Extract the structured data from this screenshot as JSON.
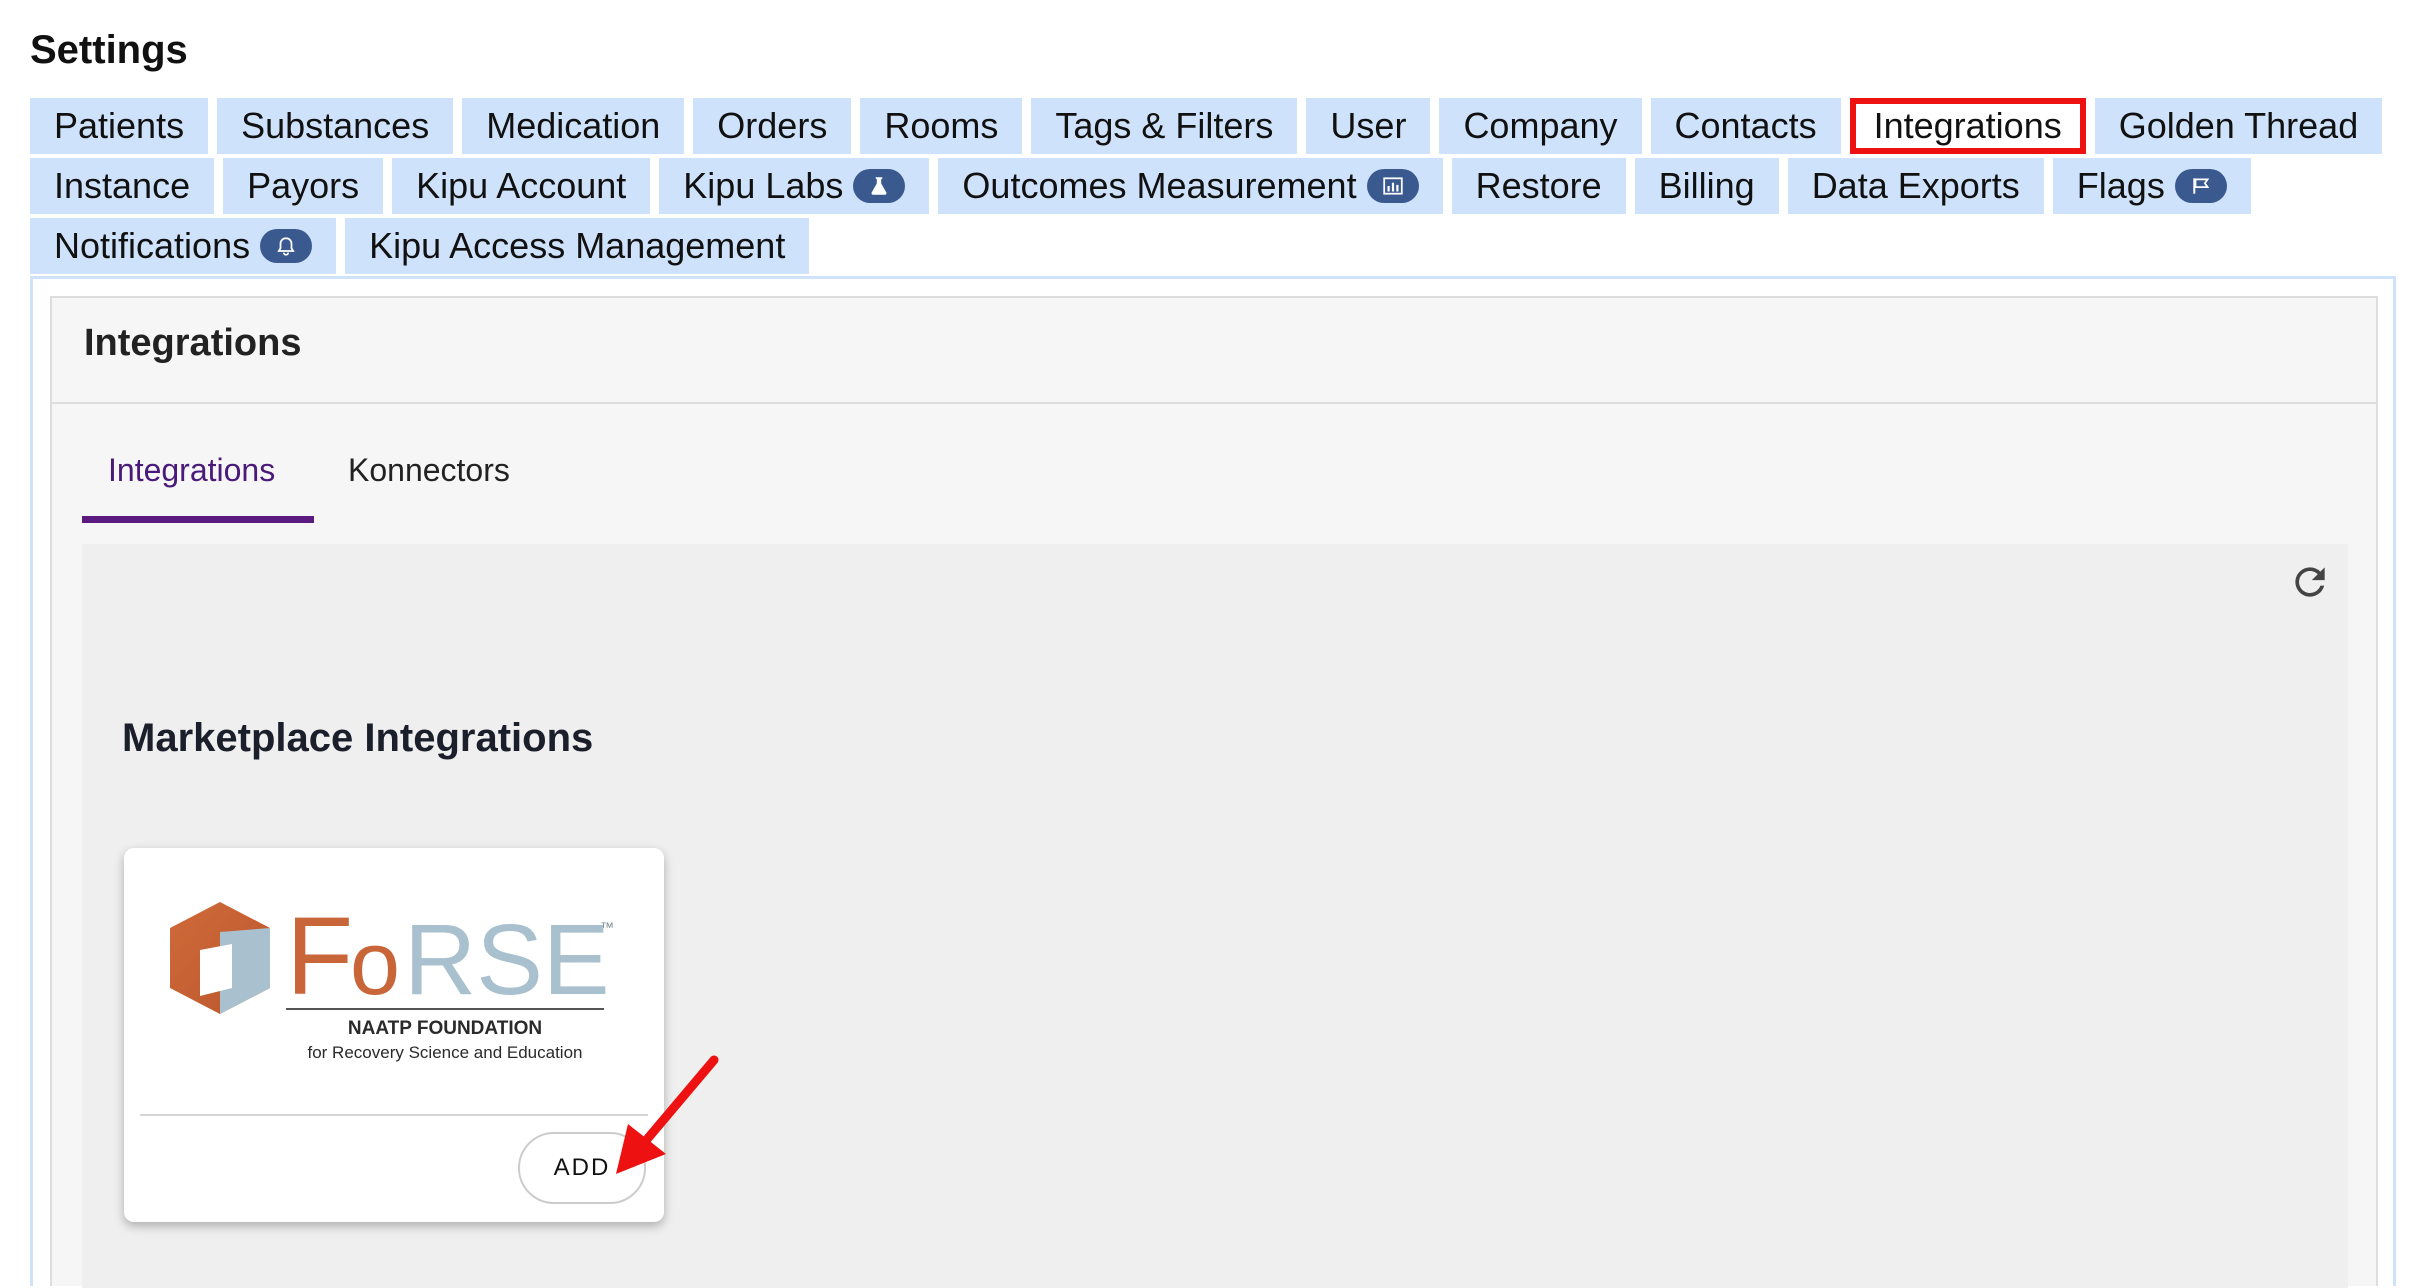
{
  "page": {
    "title": "Settings"
  },
  "tabs": {
    "rows": [
      [
        {
          "label": "Patients"
        },
        {
          "label": "Substances"
        },
        {
          "label": "Medication"
        },
        {
          "label": "Orders"
        },
        {
          "label": "Rooms"
        },
        {
          "label": "Tags & Filters"
        },
        {
          "label": "User"
        },
        {
          "label": "Company"
        },
        {
          "label": "Contacts"
        },
        {
          "label": "Integrations",
          "active": true
        },
        {
          "label": "Golden Thread"
        }
      ],
      [
        {
          "label": "Instance"
        },
        {
          "label": "Payors"
        },
        {
          "label": "Kipu Account"
        },
        {
          "label": "Kipu Labs",
          "badge": "flask-icon"
        },
        {
          "label": "Outcomes Measurement",
          "badge": "bar-chart-icon"
        },
        {
          "label": "Restore"
        },
        {
          "label": "Billing"
        },
        {
          "label": "Data Exports"
        },
        {
          "label": "Flags",
          "badge": "flag-icon"
        }
      ],
      [
        {
          "label": "Notifications",
          "badge": "bell-icon"
        },
        {
          "label": "Kipu Access Management"
        }
      ]
    ]
  },
  "panel": {
    "title": "Integrations",
    "subtabs": [
      {
        "label": "Integrations",
        "active": true
      },
      {
        "label": "Konnectors"
      }
    ],
    "refresh_icon": "refresh-icon",
    "section_heading": "Marketplace Integrations",
    "card": {
      "logo": {
        "brand_letters": {
          "f": "F",
          "o": "o",
          "rse": "RSE"
        },
        "trademark": "™",
        "line1": "NAATP FOUNDATION",
        "line2": "for Recovery Science and Education"
      },
      "add_label": "ADD"
    }
  },
  "colors": {
    "tab_bg": "#cfe2fb",
    "active_tab_outline": "#ee1111",
    "badge_bg": "#3a5a8f",
    "subtab_active": "#4a1a7a",
    "subtab_underline": "#5a1a80",
    "logo_orange": "#c8663a",
    "logo_blue": "#a9c0cf",
    "annotation_arrow": "#ee1111"
  }
}
